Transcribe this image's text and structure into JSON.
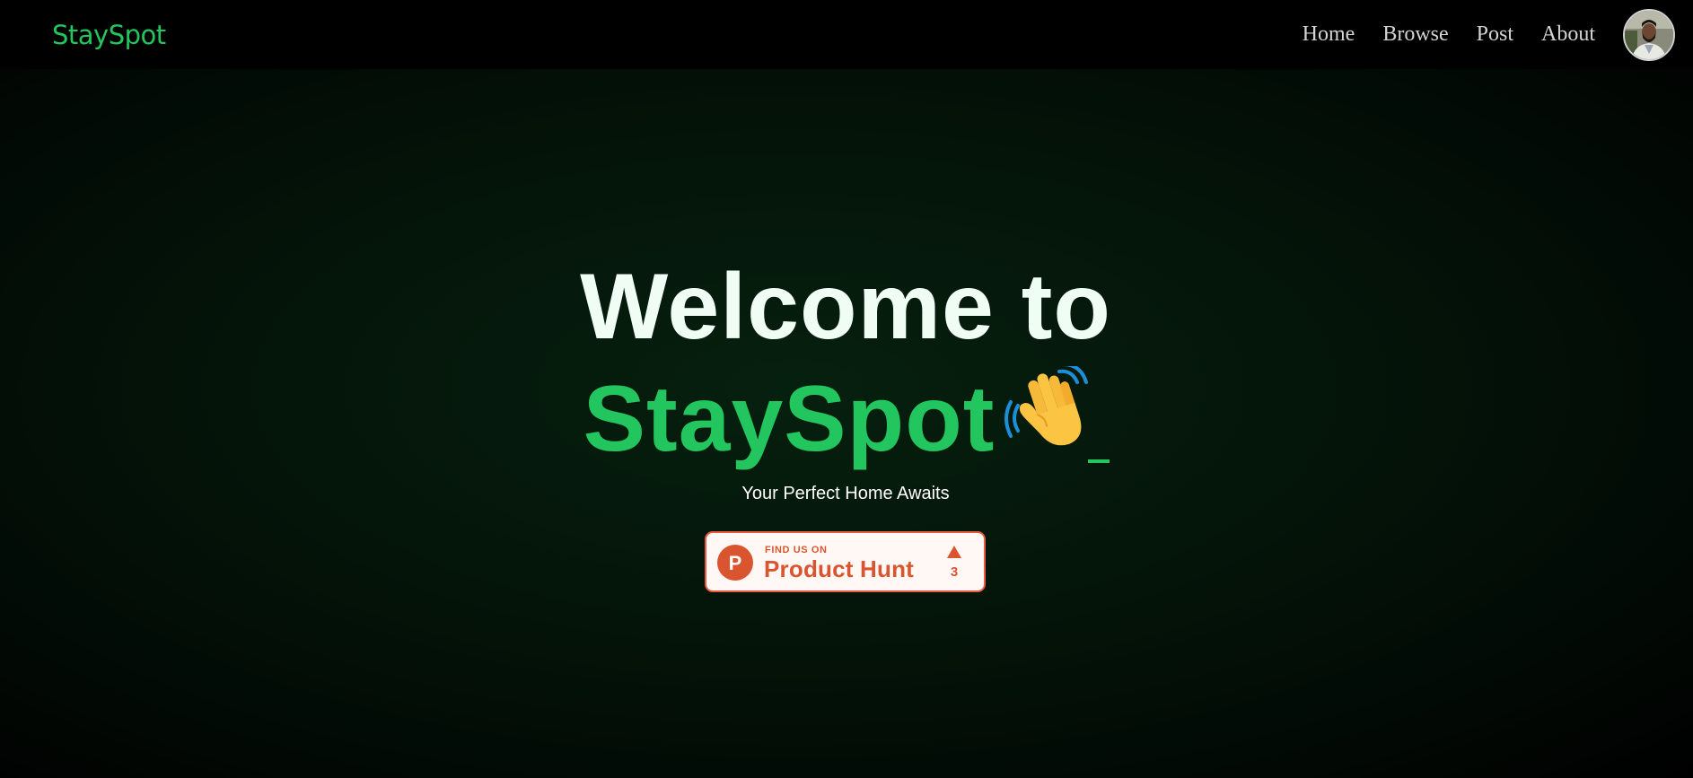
{
  "header": {
    "brand": "StaySpot",
    "nav": [
      {
        "label": "Home"
      },
      {
        "label": "Browse"
      },
      {
        "label": "Post"
      },
      {
        "label": "About"
      }
    ],
    "avatar_icon": "user-avatar"
  },
  "hero": {
    "line1": "Welcome to",
    "line2": "StaySpot",
    "emoji_icon": "waving-hand-icon",
    "cursor_char": "_",
    "subtitle": "Your Perfect Home Awaits"
  },
  "product_hunt": {
    "small_label": "FIND US ON",
    "big_label": "Product Hunt",
    "logo_letter": "P",
    "upvote_icon": "triangle-up-icon",
    "upvotes": "3"
  },
  "colors": {
    "accent": "#22c55e",
    "background": "#000000",
    "hero_text": "#f0fdf4",
    "product_hunt": "#da552f"
  }
}
